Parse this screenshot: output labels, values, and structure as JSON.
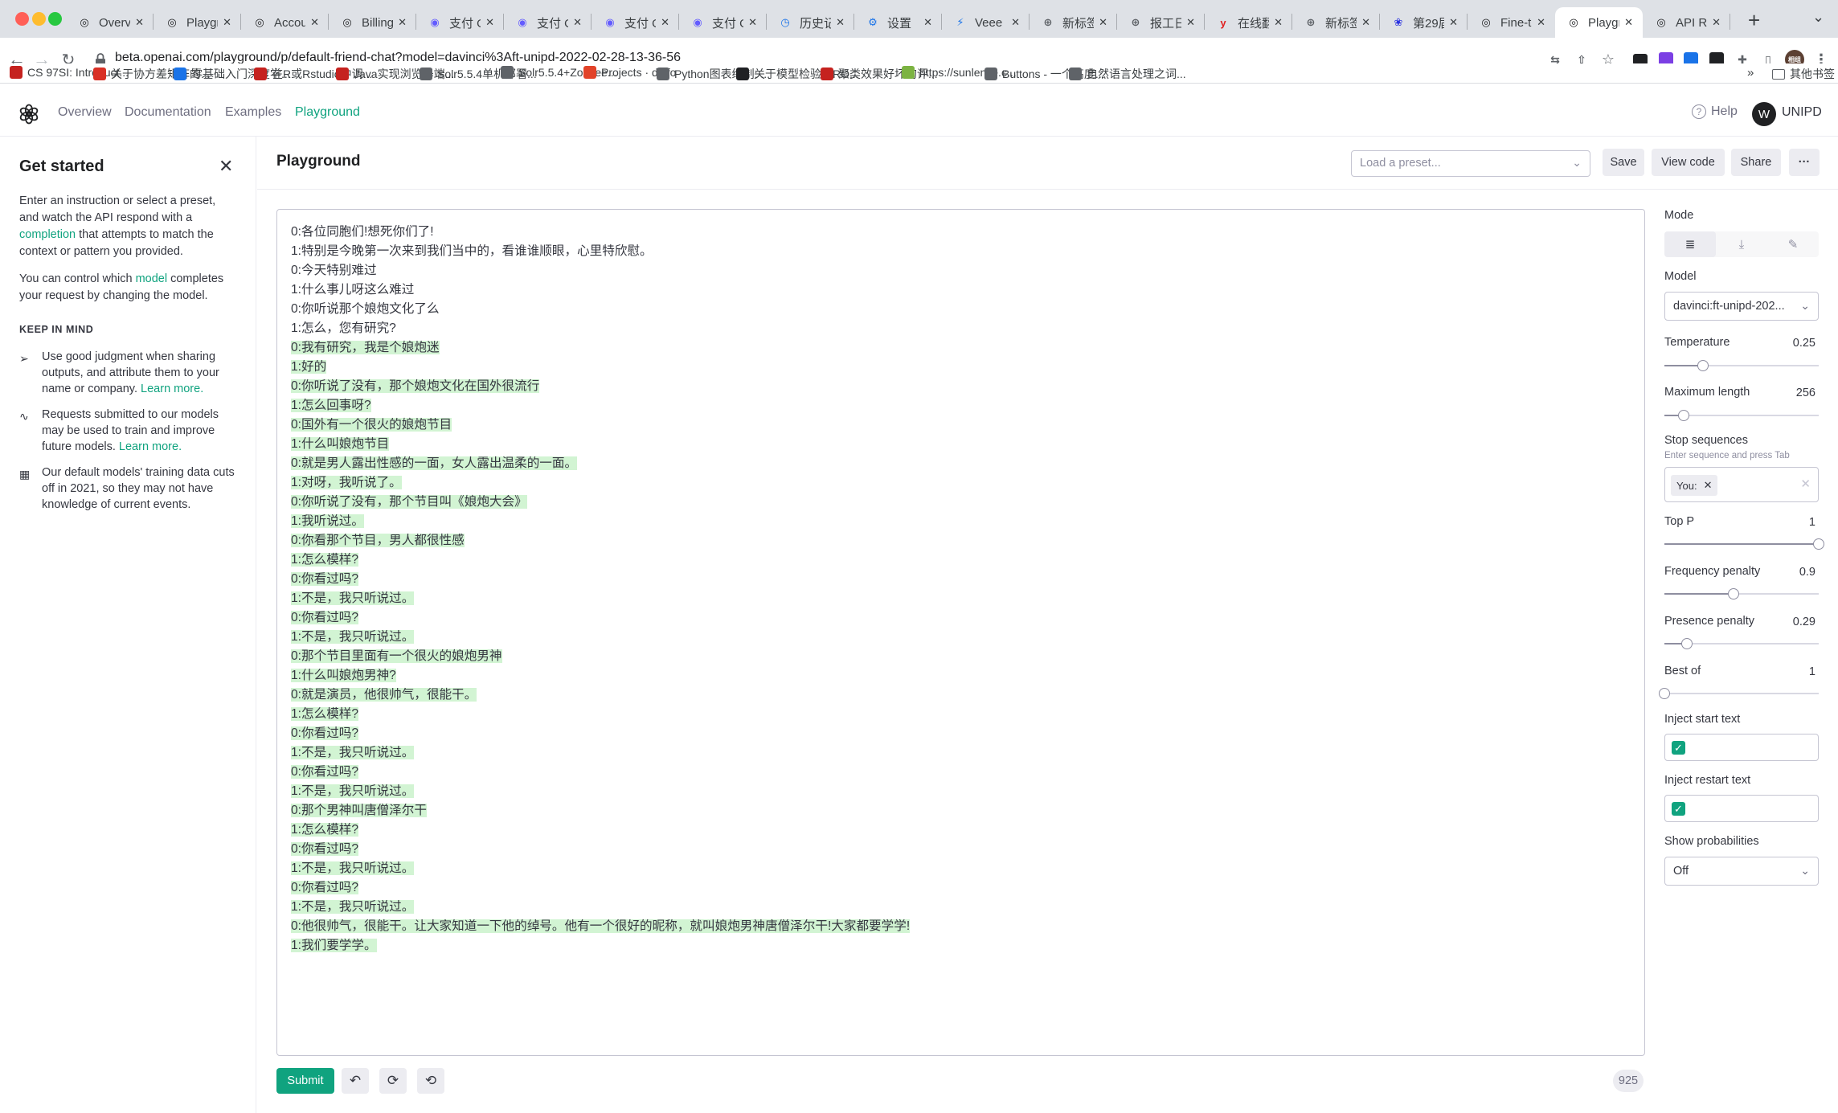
{
  "browser": {
    "tabs": [
      {
        "title": "Overvie",
        "icon": "openai"
      },
      {
        "title": "Playgro",
        "icon": "openai"
      },
      {
        "title": "Accoun",
        "icon": "openai"
      },
      {
        "title": "Billing h",
        "icon": "openai"
      },
      {
        "title": "支付 Op",
        "icon": "stripe"
      },
      {
        "title": "支付 Op",
        "icon": "stripe"
      },
      {
        "title": "支付 Op",
        "icon": "stripe"
      },
      {
        "title": "支付 Op",
        "icon": "stripe"
      },
      {
        "title": "历史记录",
        "icon": "history"
      },
      {
        "title": "设置",
        "icon": "gear"
      },
      {
        "title": "Veee - ",
        "icon": "veee"
      },
      {
        "title": "新标签页",
        "icon": "globe"
      },
      {
        "title": "报工日志",
        "icon": "globe"
      },
      {
        "title": "在线翻译",
        "icon": "youdao"
      },
      {
        "title": "新标签页",
        "icon": "globe"
      },
      {
        "title": "第29届",
        "icon": "baidu"
      },
      {
        "title": "Fine-tun",
        "icon": "openai"
      },
      {
        "title": "Playgro",
        "icon": "openai",
        "active": true
      },
      {
        "title": "API Ref",
        "icon": "openai"
      }
    ],
    "url": "beta.openai.com/playground/p/default-friend-chat?model=davinci%3Aft-unipd-2022-02-28-13-36-56",
    "bookmarks": [
      "CS 97SI: Introduct...",
      "关于协方差矩阵的...",
      "零基础入门深度学...",
      "在R或Rstudio中调...",
      "Java实现浏览器端...",
      "Solr5.5.4单机部署...",
      "Solr5.5.4+Zookee...",
      "Projects · dinfo",
      "Python图表绘制: ...",
      "关于模型检验的RO...",
      "聚类效果好坏的评...",
      "https://sunlense.c...",
      "Buttons - 一个高度...",
      "自然语言处理之词..."
    ],
    "other_bookmarks": "其他书签",
    "profile_badge": "相组"
  },
  "header": {
    "nav": [
      "Overview",
      "Documentation",
      "Examples",
      "Playground"
    ],
    "help": "Help",
    "avatar_initial": "W",
    "org": "UNIPD"
  },
  "sidebar": {
    "title": "Get started",
    "intro_before": "Enter an instruction or select a preset, and watch the API respond with a ",
    "intro_link": "completion",
    "intro_after": " that attempts to match the context or pattern you provided.",
    "model_before": "You can control which ",
    "model_link": "model",
    "model_after": " completes your request by changing the model.",
    "keep_in_mind": "KEEP IN MIND",
    "tips": [
      {
        "text": "Use good judgment when sharing outputs, and attribute them to your name or company. ",
        "link": "Learn more.",
        "icon": "send-icon"
      },
      {
        "text": "Requests submitted to our models may be used to train and improve future models. ",
        "link": "Learn more.",
        "icon": "activity-icon"
      },
      {
        "text": "Our default models' training data cuts off in 2021, so they may not have knowledge of current events.",
        "link": "",
        "icon": "calendar-icon"
      }
    ]
  },
  "main": {
    "title": "Playground",
    "preset_placeholder": "Load a preset...",
    "save": "Save",
    "view_code": "View code",
    "share": "Share",
    "more": "···",
    "submit": "Submit",
    "token_count": "925",
    "prompt_lines": [
      "0:各位同胞们!想死你们了!",
      "1:特别是今晚第一次来到我们当中的，看谁谁顺眼，心里特欣慰。",
      "0:今天特别难过",
      "1:什么事儿呀这么难过",
      "0:你听说那个娘炮文化了么",
      "1:怎么，您有研究?"
    ],
    "completion_lines": [
      "0:我有研究，我是个娘炮迷",
      "1:好的",
      "0:你听说了没有，那个娘炮文化在国外很流行",
      "1:怎么回事呀?",
      "0:国外有一个很火的娘炮节目",
      "1:什么叫娘炮节目",
      "0:就是男人露出性感的一面，女人露出温柔的一面。",
      "1:对呀，我听说了。",
      "0:你听说了没有，那个节目叫《娘炮大会》",
      "1:我听说过。",
      "0:你看那个节目，男人都很性感",
      "1:怎么模样?",
      "0:你看过吗?",
      "1:不是，我只听说过。",
      "0:你看过吗?",
      "1:不是，我只听说过。",
      "0:那个节目里面有一个很火的娘炮男神",
      "1:什么叫娘炮男神?",
      "0:就是演员，他很帅气，很能干。",
      "1:怎么模样?",
      "0:你看过吗?",
      "1:不是，我只听说过。",
      "0:你看过吗?",
      "1:不是，我只听说过。",
      "0:那个男神叫唐僧泽尔干",
      "1:怎么模样?",
      "0:你看过吗?",
      "1:不是，我只听说过。",
      "0:你看过吗?",
      "1:不是，我只听说过。",
      "0:他很帅气，很能干。让大家知道一下他的绰号。他有一个很好的昵称，就叫娘炮男神唐僧泽尔干!大家都要学学!",
      "1:我们要学学。"
    ]
  },
  "settings": {
    "mode_label": "Mode",
    "model_label": "Model",
    "model_value": "davinci:ft-unipd-202...",
    "temperature": {
      "label": "Temperature",
      "value": "0.25",
      "fraction": 0.25
    },
    "max_length": {
      "label": "Maximum length",
      "value": "256",
      "fraction": 0.125
    },
    "stop_label": "Stop sequences",
    "stop_hint": "Enter sequence and press Tab",
    "stop_chip": "You:",
    "top_p": {
      "label": "Top P",
      "value": "1",
      "fraction": 1.0
    },
    "freq": {
      "label": "Frequency penalty",
      "value": "0.9",
      "fraction": 0.45
    },
    "presence": {
      "label": "Presence penalty",
      "value": "0.29",
      "fraction": 0.145
    },
    "best_of": {
      "label": "Best of",
      "value": "1",
      "fraction": 0.0
    },
    "inject_start": "Inject start text",
    "inject_restart": "Inject restart text",
    "show_prob_label": "Show probabilities",
    "show_prob_value": "Off"
  }
}
